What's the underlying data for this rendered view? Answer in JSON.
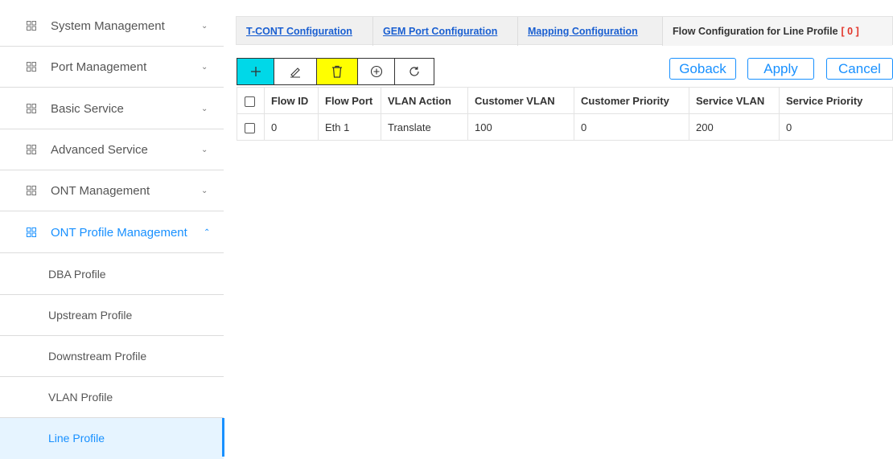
{
  "sidebar": {
    "items": [
      {
        "label": "System Management"
      },
      {
        "label": "Port Management"
      },
      {
        "label": "Basic Service"
      },
      {
        "label": "Advanced Service"
      },
      {
        "label": "ONT Management"
      },
      {
        "label": "ONT Profile Management"
      }
    ],
    "subitems": [
      {
        "label": "DBA Profile"
      },
      {
        "label": "Upstream Profile"
      },
      {
        "label": "Downstream Profile"
      },
      {
        "label": "VLAN Profile"
      },
      {
        "label": "Line Profile"
      }
    ],
    "chevron_down": "⌄",
    "chevron_up": "⌃",
    "active_color": "#1890ff"
  },
  "tabs": {
    "tcont": "T-CONT Configuration",
    "gem": "GEM Port Configuration",
    "mapping": "Mapping Configuration",
    "flow": "Flow Configuration for Line Profile",
    "flow_bracket": "[ 0 ]"
  },
  "toolbar": {
    "icons": [
      "plus-icon",
      "edit-icon",
      "trash-icon",
      "circle-plus-icon",
      "refresh-icon"
    ],
    "goback": "Goback",
    "apply": "Apply",
    "cancel": "Cancel"
  },
  "table": {
    "headers": [
      "Flow ID",
      "Flow Port",
      "VLAN Action",
      "Customer VLAN",
      "Customer Priority",
      "Service VLAN",
      "Service Priority"
    ],
    "rows": [
      [
        "0",
        "Eth 1",
        "Translate",
        "100",
        "0",
        "200",
        "0"
      ]
    ]
  }
}
